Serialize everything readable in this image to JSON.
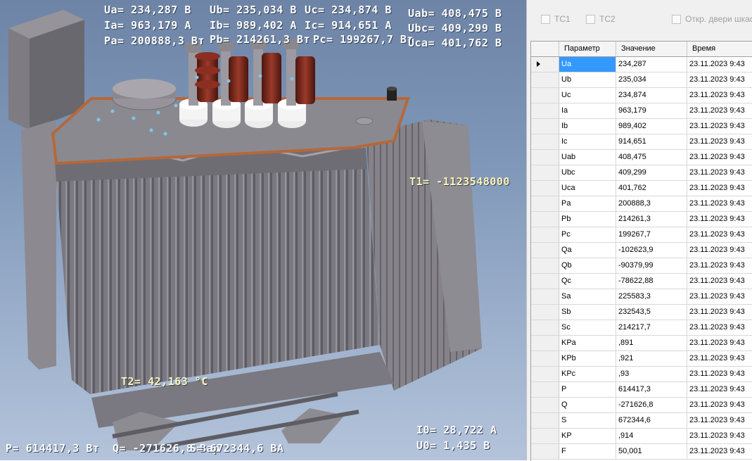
{
  "overlay": {
    "Ua": "Ua= 234,287 В",
    "Ub": "Ub= 235,034 В",
    "Uc": "Uc= 234,874 В",
    "Uab": "Uab= 408,475 В",
    "Ia": "Ia= 963,179 А",
    "Ib": "Ib= 989,402 А",
    "Ic": "Ic= 914,651 А",
    "Ubc": "Ubc= 409,299 В",
    "Pa": "Pa= 200888,3 Вт",
    "Pb": "Pb= 214261,3 Вт",
    "Pc": "Pc= 199267,7 Вт",
    "Uca": "Uca= 401,762 В",
    "T1": "T1= -1123548000",
    "T2": "T2= 42,163 °C",
    "P": "P= 614417,3 Вт",
    "Q": "Q= -271626,8 Вар",
    "S": "S= 672344,6 ВА",
    "I0": "I0= 28,722 А",
    "U0": "U0= 1,435 В"
  },
  "checkboxes": [
    {
      "label": "TC1",
      "checked": false
    },
    {
      "label": "TC2",
      "checked": false
    },
    {
      "label": "Откр. двери шкафа",
      "checked": false
    }
  ],
  "grid": {
    "columns": [
      "Параметр",
      "Значение",
      "Время"
    ],
    "rows": [
      {
        "param": "Ua",
        "value": "234,287",
        "time": "23.11.2023 9:43"
      },
      {
        "param": "Ub",
        "value": "235,034",
        "time": "23.11.2023 9:43"
      },
      {
        "param": "Uc",
        "value": "234,874",
        "time": "23.11.2023 9:43"
      },
      {
        "param": "Ia",
        "value": "963,179",
        "time": "23.11.2023 9:43"
      },
      {
        "param": "Ib",
        "value": "989,402",
        "time": "23.11.2023 9:43"
      },
      {
        "param": "Ic",
        "value": "914,651",
        "time": "23.11.2023 9:43"
      },
      {
        "param": "Uab",
        "value": "408,475",
        "time": "23.11.2023 9:43"
      },
      {
        "param": "Ubc",
        "value": "409,299",
        "time": "23.11.2023 9:43"
      },
      {
        "param": "Uca",
        "value": "401,762",
        "time": "23.11.2023 9:43"
      },
      {
        "param": "Pa",
        "value": "200888,3",
        "time": "23.11.2023 9:43"
      },
      {
        "param": "Pb",
        "value": "214261,3",
        "time": "23.11.2023 9:43"
      },
      {
        "param": "Pc",
        "value": "199267,7",
        "time": "23.11.2023 9:43"
      },
      {
        "param": "Qa",
        "value": "-102623,9",
        "time": "23.11.2023 9:43"
      },
      {
        "param": "Qb",
        "value": "-90379,99",
        "time": "23.11.2023 9:43"
      },
      {
        "param": "Qc",
        "value": "-78622,88",
        "time": "23.11.2023 9:43"
      },
      {
        "param": "Sa",
        "value": "225583,3",
        "time": "23.11.2023 9:43"
      },
      {
        "param": "Sb",
        "value": "232543,5",
        "time": "23.11.2023 9:43"
      },
      {
        "param": "Sc",
        "value": "214217,7",
        "time": "23.11.2023 9:43"
      },
      {
        "param": "KPa",
        "value": ",891",
        "time": "23.11.2023 9:43"
      },
      {
        "param": "KPb",
        "value": ",921",
        "time": "23.11.2023 9:43"
      },
      {
        "param": "KPc",
        "value": ",93",
        "time": "23.11.2023 9:43"
      },
      {
        "param": "P",
        "value": "614417,3",
        "time": "23.11.2023 9:43"
      },
      {
        "param": "Q",
        "value": "-271626,8",
        "time": "23.11.2023 9:43"
      },
      {
        "param": "S",
        "value": "672344,6",
        "time": "23.11.2023 9:43"
      },
      {
        "param": "KP",
        "value": ",914",
        "time": "23.11.2023 9:43"
      },
      {
        "param": "F",
        "value": "50,001",
        "time": "23.11.2023 9:43"
      }
    ],
    "selected_row": 0
  },
  "colors": {
    "tank": "#7d7b82",
    "bushing": "#7a2a1f",
    "selection": "#3399ff"
  }
}
